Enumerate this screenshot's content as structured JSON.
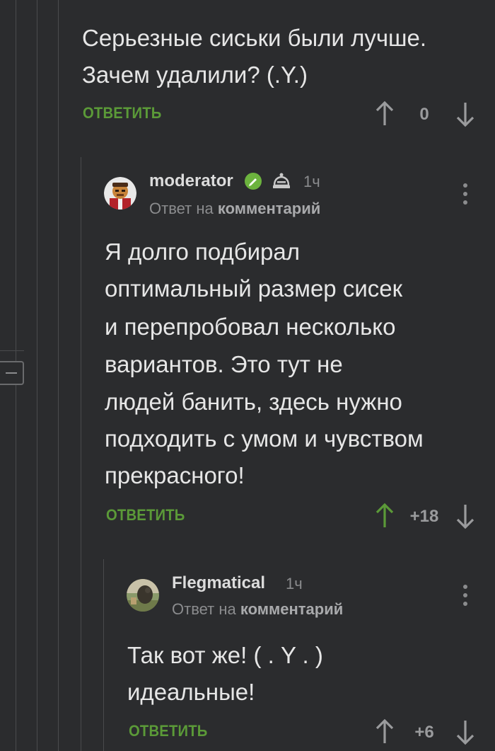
{
  "colors": {
    "background": "#2b2c2e",
    "accent_green": "#5b9a38",
    "text": "#e6e6e6",
    "muted": "#8b8c8e"
  },
  "comments": [
    {
      "text_lines": [
        "Серьезные сиськи были лучше.",
        "Зачем удалили? (.Y.)"
      ],
      "reply_label": "ОТВЕТИТЬ",
      "score": "0",
      "upvoted": false
    },
    {
      "username": "moderator",
      "time": "1ч",
      "reply_to_prefix": "Ответ на",
      "reply_to_target": "комментарий",
      "badges": [
        "verified-check-icon",
        "moderator-hat-icon"
      ],
      "text_lines": [
        "Я долго подбирал",
        "оптимальный размер сисек",
        "и перепробовал несколько",
        "вариантов. Это тут не",
        "людей банить, здесь нужно",
        "подходить с умом и чувством",
        "прекрасного!"
      ],
      "reply_label": "ОТВЕТИТЬ",
      "score": "+18",
      "upvoted": true
    },
    {
      "username": "Flegmatical",
      "time": "1ч",
      "reply_to_prefix": "Ответ на",
      "reply_to_target": "комментарий",
      "text_lines": [
        "Так вот же! ( . Y . )",
        "идеальные!"
      ],
      "reply_label": "ОТВЕТИТЬ",
      "score": "+6",
      "upvoted": false
    }
  ]
}
